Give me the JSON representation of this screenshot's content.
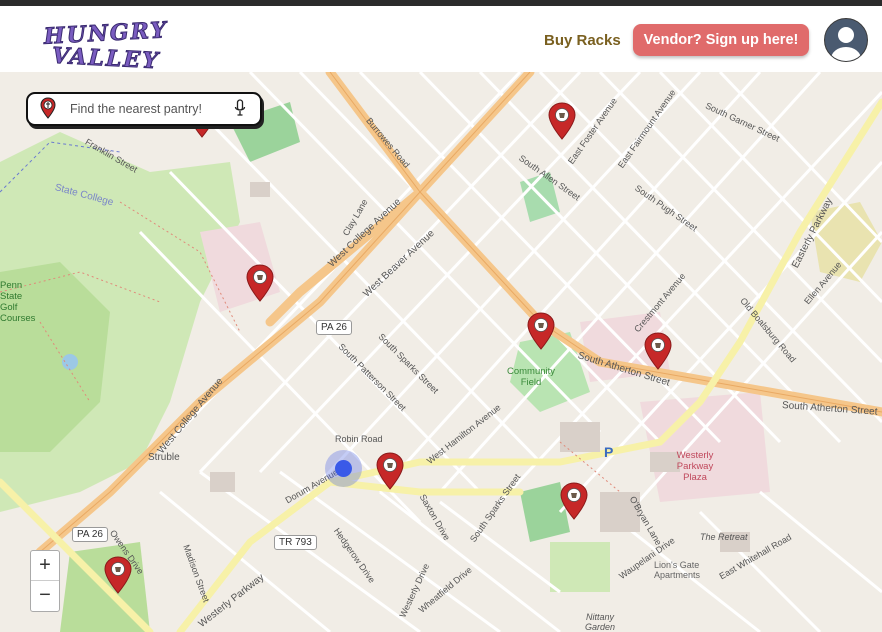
{
  "header": {
    "logo_line1": "HUNGRY",
    "logo_line2": "VALLEY",
    "buy_racks": "Buy Racks",
    "vendor_button": "Vendor? Sign up here!",
    "avatar_icon": "user-avatar-icon"
  },
  "search": {
    "placeholder": "Find the nearest pantry!",
    "pin_icon": "pantry-pin-icon",
    "mic_icon": "microphone-icon"
  },
  "zoom": {
    "in": "+",
    "out": "−"
  },
  "colors": {
    "pin_red": "#c62828",
    "vendor_button": "#e06b6b",
    "buy_racks_text": "#7a6020",
    "location_dot": "#3a5ae8"
  },
  "map_labels": {
    "west_college_ave": "West College Avenue",
    "west_beaver_ave": "West Beaver Avenue",
    "south_atherton_st": "South Atherton Street",
    "south_atherton_st2": "South Atherton Street",
    "easterly_parkway": "Easterly Parkway",
    "westerly_parkway": "Westerly Parkway",
    "west_college_ave2": "West College Avenue",
    "south_allen_st": "South Allen Street",
    "south_garner_st": "South Garner Street",
    "community_field": "Community Field",
    "westerly_parkway_plaza": "Westerly Parkway Plaza",
    "struble": "Struble",
    "pa26_a": "PA 26",
    "pa26_b": "PA 26",
    "tr793": "TR 793",
    "robin_road": "Robin Road",
    "south_sparks_st": "South Sparks Street",
    "south_patterson_st": "South Patterson Street",
    "west_hamilton_ave": "West Hamilton Avenue",
    "lions_gate": "Lion's Gate Apartments",
    "the_retreat": "The Retreat",
    "nittany_garden": "Nittany Garden",
    "state_college": "State College",
    "penn_state_golf": "Penn State Golf Courses",
    "clay_lane": "Clay Lane",
    "burrowes_road": "Burrowes Road",
    "franklin_street": "Franklin Street",
    "south_pugh_st": "South Pugh Street",
    "old_boalsburg_road": "Old Boalsburg Road",
    "dorum_avenue": "Dorum Avenue",
    "hedgerow_drive": "Hedgerow Drive",
    "saxton_drive": "Saxton Drive",
    "waupelani_drive": "Waupelani Drive",
    "east_whitehall_road": "East Whitehall Road",
    "owens_drive": "Owens Drive",
    "madison_street": "Madison Street",
    "east_foster_ave": "East Foster Avenue",
    "east_fairmount_ave": "East Fairmount Avenue",
    "south_sparks_st2": "South Sparks Street",
    "westerly_drive": "Westerly Drive",
    "wheatfield_drive": "Wheatfield Drive",
    "obryan_lane": "O'Bryan Lane",
    "ellen_avenue": "Ellen Avenue",
    "crestmont_avenue": "Crestmont Avenue",
    "parking": "P"
  }
}
